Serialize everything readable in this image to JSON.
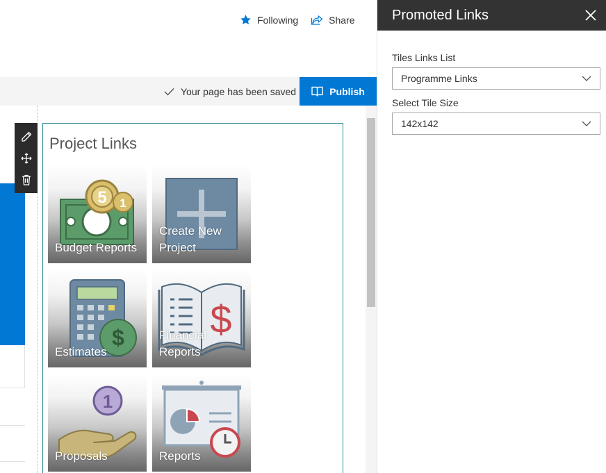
{
  "header": {
    "following_label": "Following",
    "share_label": "Share",
    "saved_status": "Your page has been saved",
    "publish_label": "Publish",
    "accent_color": "#0078d4"
  },
  "webpart": {
    "title": "Project Links",
    "tiles": [
      {
        "label": "Budget Reports",
        "icon": "money-icon"
      },
      {
        "label": "Create New Project",
        "icon": "plus-icon"
      },
      {
        "label": "Estimates",
        "icon": "calculator-icon"
      },
      {
        "label": "Financial Reports",
        "icon": "book-dollar-icon"
      },
      {
        "label": "Proposals",
        "icon": "hand-coin-icon"
      },
      {
        "label": "Reports",
        "icon": "presentation-clock-icon"
      }
    ]
  },
  "toolbar": {
    "icons": [
      "pencil-icon",
      "move-icon",
      "trash-icon"
    ]
  },
  "panel": {
    "title": "Promoted Links",
    "list_label": "Tiles Links List",
    "list_value": "Programme Links",
    "size_label": "Select Tile Size",
    "size_value": "142x142"
  }
}
